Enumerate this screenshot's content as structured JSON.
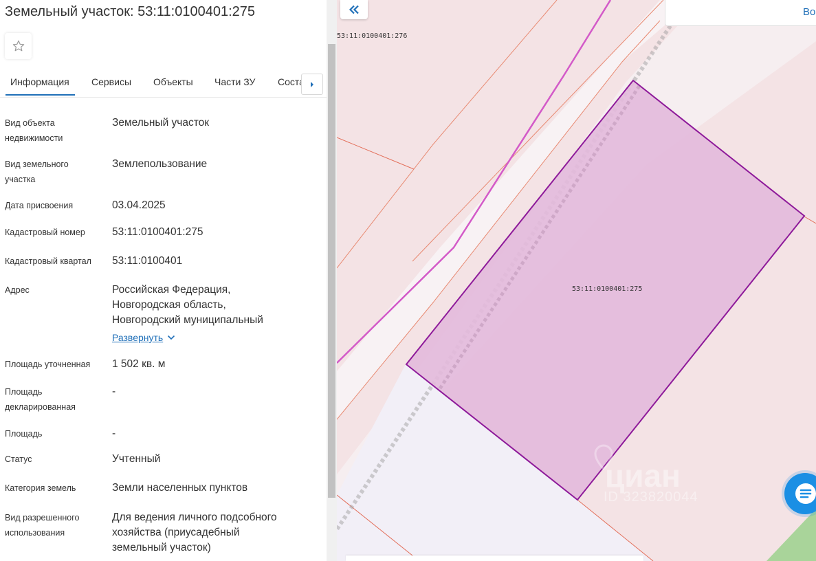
{
  "title": "Земельный участок: 53:11:0100401:275",
  "tabs": [
    {
      "label": "Информация",
      "active": true
    },
    {
      "label": "Сервисы"
    },
    {
      "label": "Объекты"
    },
    {
      "label": "Части ЗУ"
    },
    {
      "label": "Соста"
    }
  ],
  "fields": {
    "object_type": {
      "label": "Вид объекта недвижимости",
      "value": "Земельный участок"
    },
    "land_type": {
      "label": "Вид земельного участка",
      "value": "Землепользование"
    },
    "assign_date": {
      "label": "Дата присвоения",
      "value": "03.04.2025"
    },
    "cadastral_number": {
      "label": "Кадастровый номер",
      "value": "53:11:0100401:275"
    },
    "cadastral_quarter": {
      "label": "Кадастровый квартал",
      "value": "53:11:0100401"
    },
    "address": {
      "label": "Адрес",
      "lines": [
        "Российская Федерация,",
        "Новгородская область,",
        "Новгородский муниципальный"
      ],
      "expand_label": "Развернуть"
    },
    "area_precise": {
      "label": "Площадь уточненная",
      "value": "1 502 кв. м"
    },
    "area_declared": {
      "label": "Площадь декларированная",
      "value": "-"
    },
    "area": {
      "label": "Площадь",
      "value": "-"
    },
    "status": {
      "label": "Статус",
      "value": "Учтенный"
    },
    "land_category": {
      "label": "Категория земель",
      "value": "Земли населенных пунктов"
    },
    "permitted_use": {
      "label": "Вид разрешенного использования",
      "lines": [
        "Для ведения личного подсобного",
        "хозяйства (приусадебный",
        "земельный участок)"
      ]
    }
  },
  "map": {
    "search_text": "Во",
    "parcel_label": "53:11:0100401:275",
    "neighbor_label": "53:11:0100401:276",
    "watermark": "циан",
    "watermark_id": "ID 323820044"
  },
  "colors": {
    "accent": "#1f6fb8",
    "parcel_fill": "#e3b9dc",
    "parcel_stroke": "#8e1a9a",
    "map_bg": "#f4e3e5",
    "boundary": "#e36f5a"
  }
}
